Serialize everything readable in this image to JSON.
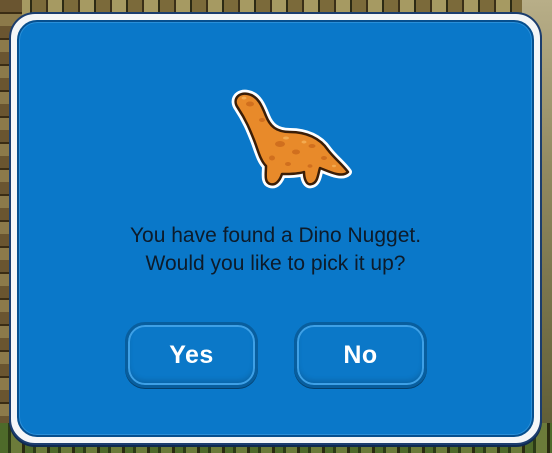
{
  "dialog": {
    "message_line_1": "You have found a Dino Nugget.",
    "message_line_2": "Would you like to pick it up?",
    "item_icon": "dino-nugget-icon",
    "yes_label": "Yes",
    "no_label": "No"
  },
  "colors": {
    "dialog_blue": "#0a78c9",
    "dialog_border": "#064f8e",
    "nugget_orange": "#e88a2a",
    "text": "#0d1b2a",
    "button_text": "#ffffff"
  }
}
